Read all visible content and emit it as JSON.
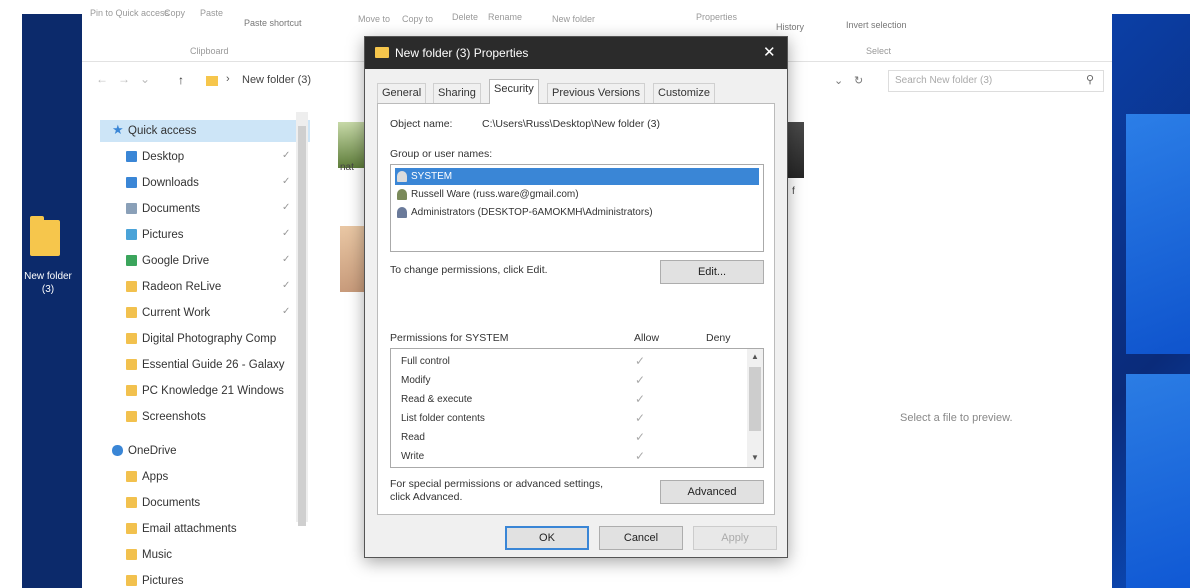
{
  "desktop": {
    "icon_label": "New folder (3)",
    "accent": "#0c2a6b"
  },
  "ribbon": {
    "pin_quick_access": "Pin to Quick access",
    "copy": "Copy",
    "paste": "Paste",
    "paste_shortcut": "Paste shortcut",
    "move_to": "Move to",
    "copy_to": "Copy to",
    "delete": "Delete",
    "rename": "Rename",
    "new_folder": "New folder",
    "properties": "Properties",
    "history": "History",
    "invert_selection": "Invert selection",
    "clipboard_group": "Clipboard",
    "select_group": "Select"
  },
  "address": {
    "path": "New folder (3)",
    "search_placeholder": "Search New folder (3)"
  },
  "nav": {
    "quick_access": "Quick access",
    "items": [
      {
        "label": "Desktop",
        "pinned": true
      },
      {
        "label": "Downloads",
        "pinned": true
      },
      {
        "label": "Documents",
        "pinned": true
      },
      {
        "label": "Pictures",
        "pinned": true
      },
      {
        "label": "Google Drive",
        "pinned": true
      },
      {
        "label": "Radeon ReLive",
        "pinned": true
      },
      {
        "label": "Current Work",
        "pinned": true
      },
      {
        "label": "Digital Photography Comp",
        "pinned": false
      },
      {
        "label": "Essential Guide 26 - Galaxy",
        "pinned": false
      },
      {
        "label": "PC Knowledge 21 Windows",
        "pinned": false
      },
      {
        "label": "Screenshots",
        "pinned": false
      }
    ],
    "onedrive": "OneDrive",
    "onedrive_items": [
      "Apps",
      "Documents",
      "Email attachments",
      "Music",
      "Pictures"
    ],
    "pin_glyph": "✓"
  },
  "content": {
    "thumb_label_1": "nat",
    "thumb_label_2": "f",
    "preview_text": "Select a file to preview."
  },
  "dialog": {
    "title": "New folder (3) Properties",
    "tabs": [
      "General",
      "Sharing",
      "Security",
      "Previous Versions",
      "Customize"
    ],
    "active_tab": "Security",
    "object_name_label": "Object name:",
    "object_name_value": "C:\\Users\\Russ\\Desktop\\New folder (3)",
    "group_label": "Group or user names:",
    "users": [
      "SYSTEM",
      "Russell Ware (russ.ware@gmail.com)",
      "Administrators (DESKTOP-6AMOKMH\\Administrators)"
    ],
    "change_text": "To change permissions, click Edit.",
    "edit_button": "Edit...",
    "permissions_label": "Permissions for SYSTEM",
    "allow_header": "Allow",
    "deny_header": "Deny",
    "permissions": [
      {
        "name": "Full control",
        "allow": "✓"
      },
      {
        "name": "Modify",
        "allow": "✓"
      },
      {
        "name": "Read & execute",
        "allow": "✓"
      },
      {
        "name": "List folder contents",
        "allow": "✓"
      },
      {
        "name": "Read",
        "allow": "✓"
      },
      {
        "name": "Write",
        "allow": "✓"
      }
    ],
    "special_text_1": "For special permissions or advanced settings,",
    "special_text_2": "click Advanced.",
    "advanced_button": "Advanced",
    "ok_button": "OK",
    "cancel_button": "Cancel",
    "apply_button": "Apply",
    "close_glyph": "✕"
  }
}
